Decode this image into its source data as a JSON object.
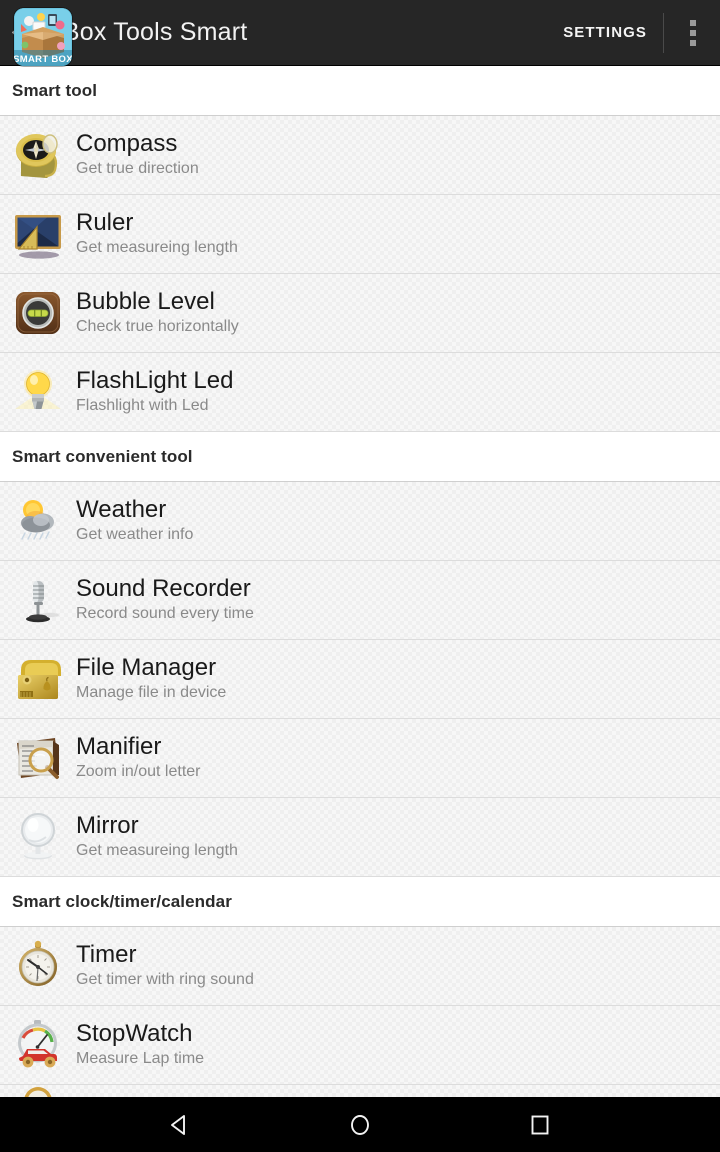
{
  "app": {
    "title": "ABox Tools Smart",
    "logo_text": "SMART BOX",
    "up_icon": "back-chevron-icon"
  },
  "actionbar": {
    "settings_label": "SETTINGS",
    "overflow_icon": "overflow-menu-icon"
  },
  "colors": {
    "actionbar_bg": "#262626",
    "navbar_bg": "#000000",
    "row_bg": "#f7f7f7",
    "section_bg": "#ffffff",
    "title_text": "#1a1a1a",
    "subtitle_text": "#8a8a8a",
    "logo_bg": "#7fd4ef"
  },
  "sections": [
    {
      "header": "Smart tool",
      "items": [
        {
          "icon": "compass-icon",
          "title": "Compass",
          "subtitle": "Get true direction"
        },
        {
          "icon": "ruler-icon",
          "title": "Ruler",
          "subtitle": "Get measureing length"
        },
        {
          "icon": "bubble-level-icon",
          "title": "Bubble Level",
          "subtitle": "Check true horizontally"
        },
        {
          "icon": "flashlight-icon",
          "title": "FlashLight Led",
          "subtitle": "Flashlight with Led"
        }
      ]
    },
    {
      "header": "Smart convenient tool",
      "items": [
        {
          "icon": "weather-icon",
          "title": "Weather",
          "subtitle": "Get weather info"
        },
        {
          "icon": "microphone-icon",
          "title": "Sound Recorder",
          "subtitle": "Record sound every time"
        },
        {
          "icon": "file-manager-icon",
          "title": "File Manager",
          "subtitle": "Manage file in device"
        },
        {
          "icon": "magnifier-icon",
          "title": "Manifier",
          "subtitle": "Zoom in/out letter"
        },
        {
          "icon": "mirror-icon",
          "title": "Mirror",
          "subtitle": "Get measureing length"
        }
      ]
    },
    {
      "header": "Smart clock/timer/calendar",
      "items": [
        {
          "icon": "timer-icon",
          "title": "Timer",
          "subtitle": "Get timer with ring sound"
        },
        {
          "icon": "stopwatch-icon",
          "title": "StopWatch",
          "subtitle": "Measure Lap time"
        },
        {
          "icon": "clock-icon",
          "title": "",
          "subtitle": ""
        }
      ]
    }
  ],
  "navbar": {
    "back_label": "back-triangle-icon",
    "home_label": "home-circle-icon",
    "recents_label": "recents-square-icon"
  }
}
